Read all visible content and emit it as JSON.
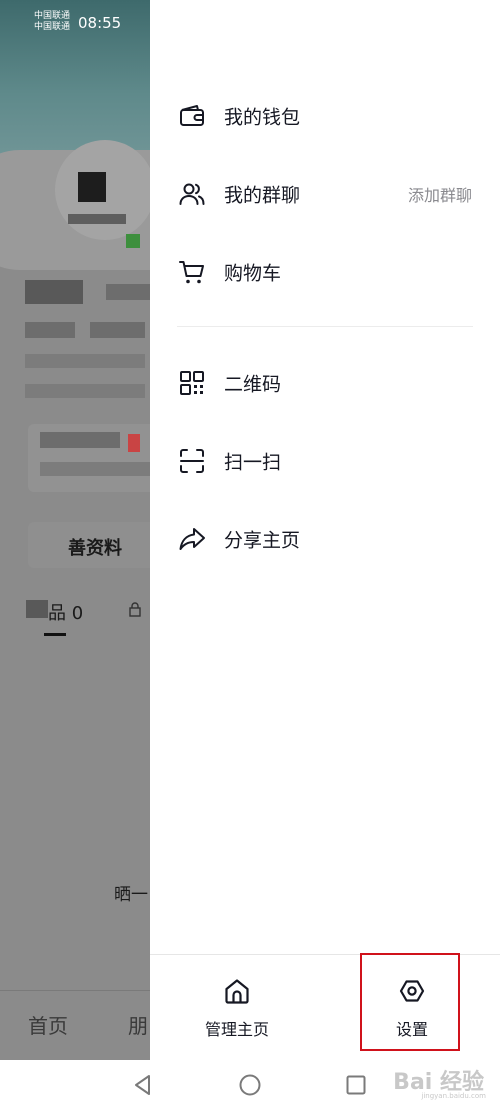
{
  "status_bar": {
    "carrier_1": "中国联通",
    "carrier_2": "中国联通",
    "time": "08:55"
  },
  "background_page": {
    "edit_profile_label": "善资料",
    "works_tab": "品 0",
    "bottom_hint": "晒一",
    "nav_home": "首页",
    "nav_partial": "朋"
  },
  "drawer": {
    "menu_items": [
      {
        "label": "我的钱包",
        "icon": "wallet-icon"
      },
      {
        "label": "我的群聊",
        "icon": "group-chat-icon",
        "extra": "添加群聊"
      },
      {
        "label": "购物车",
        "icon": "shopping-cart-icon"
      },
      {
        "label": "二维码",
        "icon": "qr-code-icon"
      },
      {
        "label": "扫一扫",
        "icon": "scan-icon"
      },
      {
        "label": "分享主页",
        "icon": "share-icon"
      }
    ],
    "bottom": {
      "manage_home_label": "管理主页",
      "settings_label": "设置"
    }
  },
  "watermark": {
    "brand": "Bai 经验",
    "url": "jingyan.baidu.com"
  },
  "colors": {
    "highlight_border": "#d0121b",
    "menu_text": "#161823",
    "extra_text": "#8a8a8f"
  }
}
